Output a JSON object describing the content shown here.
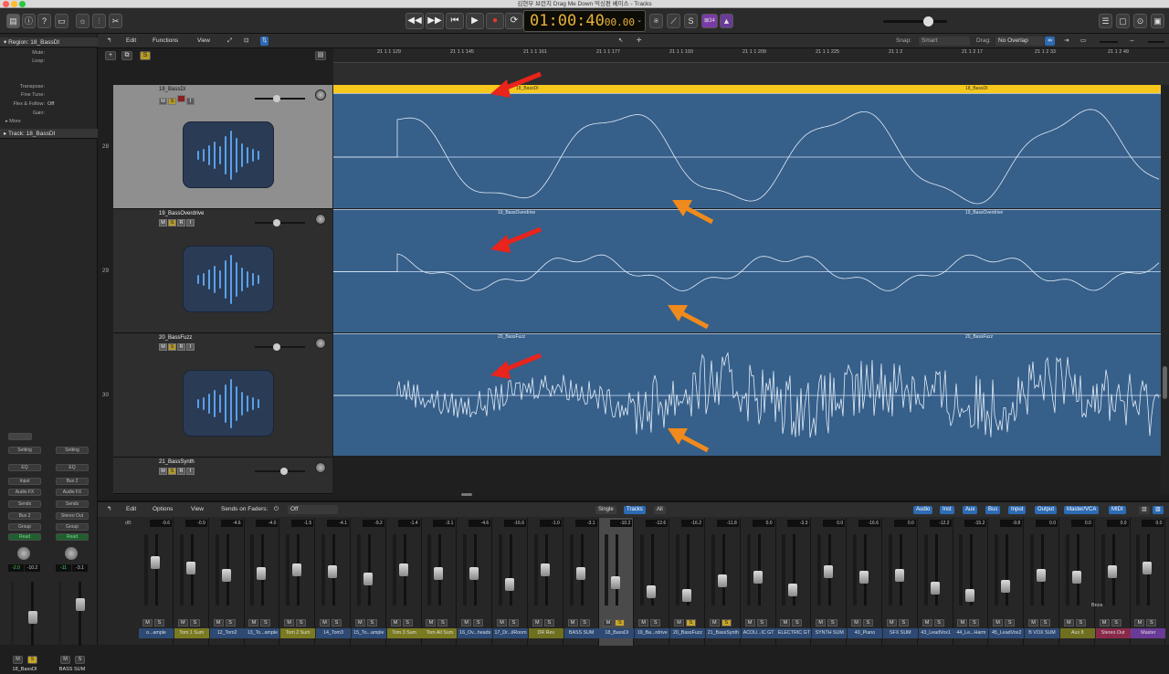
{
  "window": {
    "title": "김현부 브런치 Drag Me Down 믹싱편 베이스 - Tracks"
  },
  "transport": {
    "time": "01:00:40",
    "time_frac": "00.00",
    "tempo_badge": "⊠34"
  },
  "inspector": {
    "region_header": "Region: 18_BassDI",
    "rows": [
      {
        "label": "Mute:",
        "value": ""
      },
      {
        "label": "Loop:",
        "value": ""
      },
      {
        "label": "Transpose:",
        "value": ""
      },
      {
        "label": "Fine Tune:",
        "value": ""
      },
      {
        "label": "Flex & Follow:",
        "value": "Off"
      },
      {
        "label": "Gain:",
        "value": ""
      }
    ],
    "more": "More",
    "track_header": "Track:  18_BassDI",
    "strip1": {
      "setting": "Setting",
      "eq": "EQ",
      "input": "Input",
      "audio_fx": "Audio FX",
      "sends": "Sends",
      "output": "Bus 2",
      "group": "Group",
      "automation": "Read",
      "lvl_a": "-2.0",
      "lvl_b": "-10.2",
      "mute": "M",
      "solo": "S",
      "name": "18_BassDI"
    },
    "strip2": {
      "setting": "Setting",
      "eq": "EQ",
      "input": "Bus 2",
      "audio_fx": "Audio FX",
      "sends": "Sends",
      "output": "Stereo Out",
      "group": "Group",
      "automation": "Read",
      "lvl_a": "-11",
      "lvl_b": "-3.1",
      "mute": "M",
      "solo": "S",
      "name": "BASS SUM"
    }
  },
  "tracks_menu": {
    "edit": "Edit",
    "functions": "Functions",
    "view": "View",
    "snap_label": "Snap:",
    "snap_value": "Smart",
    "drag_label": "Drag:",
    "drag_value": "No Overlap"
  },
  "ruler": {
    "ticks": [
      "21 1 1 129",
      "21 1 1 145",
      "21 1 1 161",
      "21 1 1 177",
      "21 1 1 193",
      "21 1 1 209",
      "21 1 1 225",
      "21 1 2",
      "21 1 2 17",
      "21 1 2 33",
      "21 1 2 49"
    ]
  },
  "tracks": [
    {
      "number": "28",
      "name": "18_BassDI",
      "region": "18_BassDI",
      "selected": true
    },
    {
      "number": "29",
      "name": "19_BassOverdrive",
      "region": "19_BassOverdrive",
      "selected": false
    },
    {
      "number": "30",
      "name": "20_BassFuzz",
      "region": "20_BassFuzz",
      "selected": false
    },
    {
      "number": "",
      "name": "21_BassSynth",
      "region": "",
      "selected": false
    }
  ],
  "track_buttons": {
    "m": "M",
    "s": "S",
    "r": "R",
    "i": "I"
  },
  "mixer": {
    "edit": "Edit",
    "options": "Options",
    "view": "View",
    "sends_label": "Sends on Faders:",
    "sends_value": "Off",
    "view_tabs": [
      "Single",
      "Tracks",
      "All"
    ],
    "filters": [
      "Audio",
      "Inst",
      "Aux",
      "Bus",
      "Input",
      "Output",
      "Master/VCA",
      "MIDI"
    ],
    "channels": [
      {
        "name": "o...ample",
        "lvl": "-9.6"
      },
      {
        "name": "Tom 1 Sum",
        "lvl": "-0.9"
      },
      {
        "name": "12_Tom2",
        "lvl": "-4.6"
      },
      {
        "name": "13_To...ample",
        "lvl": "-4.0"
      },
      {
        "name": "Tom 2 Sum",
        "lvl": "-1.5"
      },
      {
        "name": "14_Tom3",
        "lvl": "-4.1"
      },
      {
        "name": "15_To...ample",
        "lvl": "-9.2"
      },
      {
        "name": "Tom 3 Sum",
        "lvl": "-1.4"
      },
      {
        "name": "Tom All Sum",
        "lvl": "-3.1"
      },
      {
        "name": "16_Ov...heads",
        "lvl": "-4.6"
      },
      {
        "name": "17_Dr...ilRoom",
        "lvl": "-16.6"
      },
      {
        "name": "DR Rev",
        "lvl": "-1.0"
      },
      {
        "name": "BASS SUM",
        "lvl": "-3.1"
      },
      {
        "name": "18_BassDI",
        "lvl": "-10.2"
      },
      {
        "name": "19_Ba...rdrive",
        "lvl": "-12.6"
      },
      {
        "name": "20_BassFuzz",
        "lvl": "-16.2"
      },
      {
        "name": "21_BassSynth",
        "lvl": "-11.8"
      },
      {
        "name": "ACOU...IC GT",
        "lvl": "0.0"
      },
      {
        "name": "ELECTRIC GT",
        "lvl": "-3.3"
      },
      {
        "name": "SYNTH SUM",
        "lvl": "0.0"
      },
      {
        "name": "40_Piano",
        "lvl": "-16.6"
      },
      {
        "name": "SFX SUM",
        "lvl": "0.0"
      },
      {
        "name": "43_LeadVox1",
        "lvl": "-12.2"
      },
      {
        "name": "44_Le...Harm",
        "lvl": "-15.2"
      },
      {
        "name": "45_LeadVox2",
        "lvl": "-9.8"
      },
      {
        "name": "B VOX SUM",
        "lvl": "0.0"
      },
      {
        "name": "Aux 8",
        "lvl": "0.0"
      },
      {
        "name": "Stereo Out",
        "lvl": "0.0"
      },
      {
        "name": "Master",
        "lvl": "0.0"
      }
    ],
    "bnce": "Bnce"
  },
  "colors": {
    "region_blue": "#365f8a",
    "selected_yellow": "#f6c81c",
    "lcd_amber": "#e7b23a",
    "arrow_red": "#e8241c",
    "arrow_orange": "#f08a1c"
  }
}
